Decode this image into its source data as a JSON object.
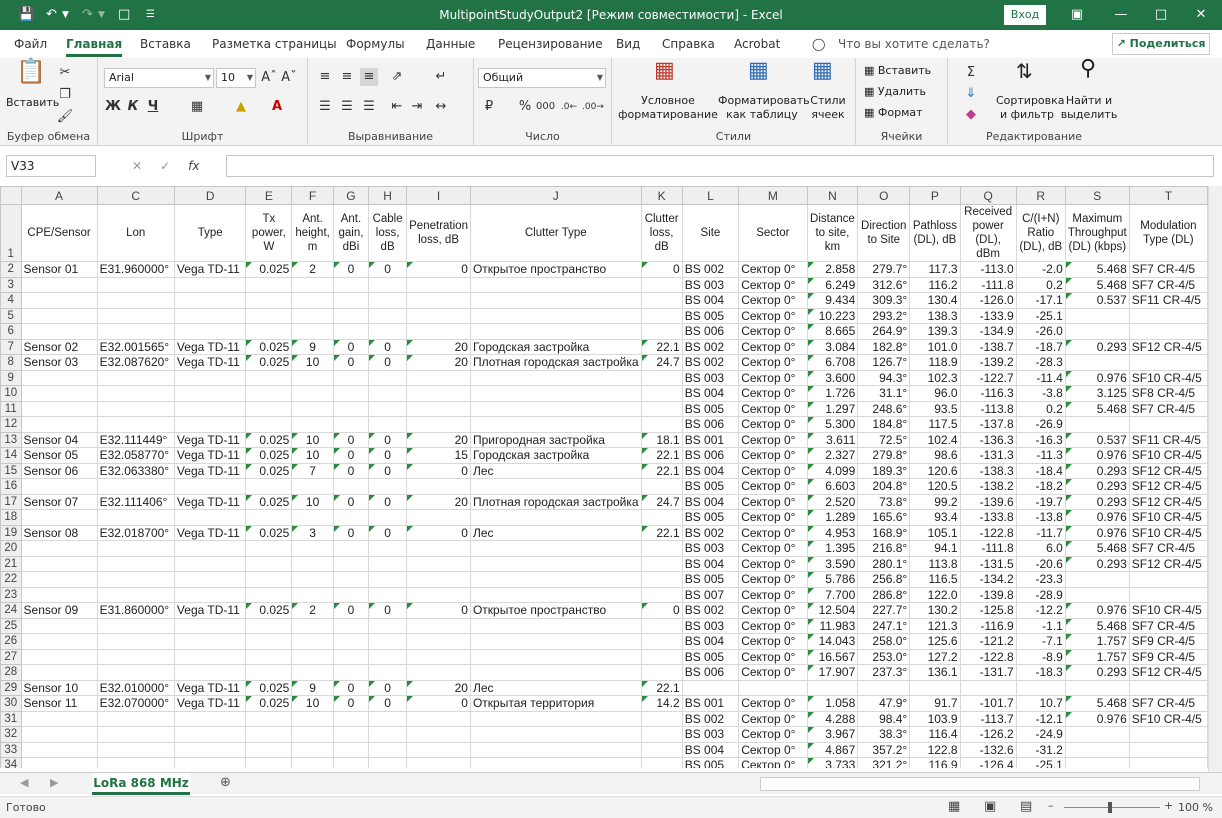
{
  "titlebar": {
    "title": "MultipointStudyOutput2  [Режим совместимости]  -  Excel",
    "signin": "Вход",
    "save_icon": "save-icon",
    "undo_icon": "undo-icon",
    "redo_icon": "redo-icon",
    "new_icon": "new-file-icon"
  },
  "tabs": [
    "Файл",
    "Главная",
    "Вставка",
    "Разметка страницы",
    "Формулы",
    "Данные",
    "Рецензирование",
    "Вид",
    "Справка",
    "Acrobat"
  ],
  "tellme": "Что вы хотите сделать?",
  "share": "Поделиться",
  "ribbon": {
    "paste": "Вставить",
    "clipboard": "Буфер обмена",
    "font_name": "Arial",
    "font_size": "10",
    "font_group": "Шрифт",
    "bold": "Ж",
    "italic": "К",
    "underline": "Ч",
    "align_group": "Выравнивание",
    "number_format": "Общий",
    "number_group": "Число",
    "cond_format": "Условное форматирование",
    "format_table": "Форматировать как таблицу",
    "cell_styles": "Стили ячеек",
    "styles_group": "Стили",
    "insert": "Вставить",
    "delete": "Удалить",
    "format": "Формат",
    "cells_group": "Ячейки",
    "sort": "Сортировка и фильтр",
    "find": "Найти и выделить",
    "edit_group": "Редактирование"
  },
  "namebox": "V33",
  "columns": [
    "A",
    "C",
    "D",
    "E",
    "F",
    "G",
    "H",
    "I",
    "J",
    "K",
    "L",
    "M",
    "N",
    "O",
    "P",
    "Q",
    "R",
    "S",
    "T"
  ],
  "headers": [
    "CPE/Sensor",
    "Lon",
    "Type",
    "Tx power, W",
    "Ant. height, m",
    "Ant. gain, dBi",
    "Cable loss, dB",
    "Penetration loss, dB",
    "Clutter Type",
    "Clutter loss, dB",
    "Site",
    "Sector",
    "Distance to site, km",
    "Direction to Site",
    "Pathloss (DL), dB",
    "Received power (DL), dBm",
    "C/(I+N) Ratio (DL), dB",
    "Maximum Throughput (DL) (kbps)",
    "Modulation Type (DL)"
  ],
  "rows": [
    [
      "2",
      "Sensor 01",
      "E31.960000°",
      "Vega TD-11",
      "0.025",
      "2",
      "0",
      "0",
      "0",
      "Открытое пространство",
      "0",
      "BS 002",
      "Сектор 0°",
      "2.858",
      "279.7°",
      "117.3",
      "-113.0",
      "-2.0",
      "5.468",
      "SF7 CR-4/5"
    ],
    [
      "3",
      "",
      "",
      "",
      "",
      "",
      "",
      "",
      "",
      "",
      "",
      "BS 003",
      "Сектор 0°",
      "6.249",
      "312.6°",
      "116.2",
      "-111.8",
      "0.2",
      "5.468",
      "SF7 CR-4/5"
    ],
    [
      "4",
      "",
      "",
      "",
      "",
      "",
      "",
      "",
      "",
      "",
      "",
      "BS 004",
      "Сектор 0°",
      "9.434",
      "309.3°",
      "130.4",
      "-126.0",
      "-17.1",
      "0.537",
      "SF11 CR-4/5"
    ],
    [
      "5",
      "",
      "",
      "",
      "",
      "",
      "",
      "",
      "",
      "",
      "",
      "BS 005",
      "Сектор 0°",
      "10.223",
      "293.2°",
      "138.3",
      "-133.9",
      "-25.1",
      "",
      ""
    ],
    [
      "6",
      "",
      "",
      "",
      "",
      "",
      "",
      "",
      "",
      "",
      "",
      "BS 006",
      "Сектор 0°",
      "8.665",
      "264.9°",
      "139.3",
      "-134.9",
      "-26.0",
      "",
      ""
    ],
    [
      "7",
      "Sensor 02",
      "E32.001565°",
      "Vega TD-11",
      "0.025",
      "9",
      "0",
      "0",
      "20",
      "Городская застройка",
      "22.1",
      "BS 002",
      "Сектор 0°",
      "3.084",
      "182.8°",
      "101.0",
      "-138.7",
      "-18.7",
      "0.293",
      "SF12 CR-4/5"
    ],
    [
      "8",
      "Sensor 03",
      "E32.087620°",
      "Vega TD-11",
      "0.025",
      "10",
      "0",
      "0",
      "20",
      "Плотная городская застройка",
      "24.7",
      "BS 002",
      "Сектор 0°",
      "6.708",
      "126.7°",
      "118.9",
      "-139.2",
      "-28.3",
      "",
      ""
    ],
    [
      "9",
      "",
      "",
      "",
      "",
      "",
      "",
      "",
      "",
      "",
      "",
      "BS 003",
      "Сектор 0°",
      "3.600",
      "94.3°",
      "102.3",
      "-122.7",
      "-11.4",
      "0.976",
      "SF10 CR-4/5"
    ],
    [
      "10",
      "",
      "",
      "",
      "",
      "",
      "",
      "",
      "",
      "",
      "",
      "BS 004",
      "Сектор 0°",
      "1.726",
      "31.1°",
      "96.0",
      "-116.3",
      "-3.8",
      "3.125",
      "SF8 CR-4/5"
    ],
    [
      "11",
      "",
      "",
      "",
      "",
      "",
      "",
      "",
      "",
      "",
      "",
      "BS 005",
      "Сектор 0°",
      "1.297",
      "248.6°",
      "93.5",
      "-113.8",
      "0.2",
      "5.468",
      "SF7 CR-4/5"
    ],
    [
      "12",
      "",
      "",
      "",
      "",
      "",
      "",
      "",
      "",
      "",
      "",
      "BS 006",
      "Сектор 0°",
      "5.300",
      "184.8°",
      "117.5",
      "-137.8",
      "-26.9",
      "",
      ""
    ],
    [
      "13",
      "Sensor 04",
      "E32.111449°",
      "Vega TD-11",
      "0.025",
      "10",
      "0",
      "0",
      "20",
      "Пригородная застройка",
      "18.1",
      "BS 001",
      "Сектор 0°",
      "3.611",
      "72.5°",
      "102.4",
      "-136.3",
      "-16.3",
      "0.537",
      "SF11 CR-4/5"
    ],
    [
      "14",
      "Sensor 05",
      "E32.058770°",
      "Vega TD-11",
      "0.025",
      "10",
      "0",
      "0",
      "15",
      "Городская застройка",
      "22.1",
      "BS 006",
      "Сектор 0°",
      "2.327",
      "279.8°",
      "98.6",
      "-131.3",
      "-11.3",
      "0.976",
      "SF10 CR-4/5"
    ],
    [
      "15",
      "Sensor 06",
      "E32.063380°",
      "Vega TD-11",
      "0.025",
      "7",
      "0",
      "0",
      "0",
      "Лес",
      "22.1",
      "BS 004",
      "Сектор 0°",
      "4.099",
      "189.3°",
      "120.6",
      "-138.3",
      "-18.4",
      "0.293",
      "SF12 CR-4/5"
    ],
    [
      "16",
      "",
      "",
      "",
      "",
      "",
      "",
      "",
      "",
      "",
      "",
      "BS 005",
      "Сектор 0°",
      "6.603",
      "204.8°",
      "120.5",
      "-138.2",
      "-18.2",
      "0.293",
      "SF12 CR-4/5"
    ],
    [
      "17",
      "Sensor 07",
      "E32.111406°",
      "Vega TD-11",
      "0.025",
      "10",
      "0",
      "0",
      "20",
      "Плотная городская застройка",
      "24.7",
      "BS 004",
      "Сектор 0°",
      "2.520",
      "73.8°",
      "99.2",
      "-139.6",
      "-19.7",
      "0.293",
      "SF12 CR-4/5"
    ],
    [
      "18",
      "",
      "",
      "",
      "",
      "",
      "",
      "",
      "",
      "",
      "",
      "BS 005",
      "Сектор 0°",
      "1.289",
      "165.6°",
      "93.4",
      "-133.8",
      "-13.8",
      "0.976",
      "SF10 CR-4/5"
    ],
    [
      "19",
      "Sensor 08",
      "E32.018700°",
      "Vega TD-11",
      "0.025",
      "3",
      "0",
      "0",
      "0",
      "Лес",
      "22.1",
      "BS 002",
      "Сектор 0°",
      "4.953",
      "168.9°",
      "105.1",
      "-122.8",
      "-11.7",
      "0.976",
      "SF10 CR-4/5"
    ],
    [
      "20",
      "",
      "",
      "",
      "",
      "",
      "",
      "",
      "",
      "",
      "",
      "BS 003",
      "Сектор 0°",
      "1.395",
      "216.8°",
      "94.1",
      "-111.8",
      "6.0",
      "5.468",
      "SF7 CR-4/5"
    ],
    [
      "21",
      "",
      "",
      "",
      "",
      "",
      "",
      "",
      "",
      "",
      "",
      "BS 004",
      "Сектор 0°",
      "3.590",
      "280.1°",
      "113.8",
      "-131.5",
      "-20.6",
      "0.293",
      "SF12 CR-4/5"
    ],
    [
      "22",
      "",
      "",
      "",
      "",
      "",
      "",
      "",
      "",
      "",
      "",
      "BS 005",
      "Сектор 0°",
      "5.786",
      "256.8°",
      "116.5",
      "-134.2",
      "-23.3",
      "",
      ""
    ],
    [
      "23",
      "",
      "",
      "",
      "",
      "",
      "",
      "",
      "",
      "",
      "",
      "BS 007",
      "Сектор 0°",
      "7.700",
      "286.8°",
      "122.0",
      "-139.8",
      "-28.9",
      "",
      ""
    ],
    [
      "24",
      "Sensor 09",
      "E31.860000°",
      "Vega TD-11",
      "0.025",
      "2",
      "0",
      "0",
      "0",
      "Открытое пространство",
      "0",
      "BS 002",
      "Сектор 0°",
      "12.504",
      "227.7°",
      "130.2",
      "-125.8",
      "-12.2",
      "0.976",
      "SF10 CR-4/5"
    ],
    [
      "25",
      "",
      "",
      "",
      "",
      "",
      "",
      "",
      "",
      "",
      "",
      "BS 003",
      "Сектор 0°",
      "11.983",
      "247.1°",
      "121.3",
      "-116.9",
      "-1.1",
      "5.468",
      "SF7 CR-4/5"
    ],
    [
      "26",
      "",
      "",
      "",
      "",
      "",
      "",
      "",
      "",
      "",
      "",
      "BS 004",
      "Сектор 0°",
      "14.043",
      "258.0°",
      "125.6",
      "-121.2",
      "-7.1",
      "1.757",
      "SF9 CR-4/5"
    ],
    [
      "27",
      "",
      "",
      "",
      "",
      "",
      "",
      "",
      "",
      "",
      "",
      "BS 005",
      "Сектор 0°",
      "16.567",
      "253.0°",
      "127.2",
      "-122.8",
      "-8.9",
      "1.757",
      "SF9 CR-4/5"
    ],
    [
      "28",
      "",
      "",
      "",
      "",
      "",
      "",
      "",
      "",
      "",
      "",
      "BS 006",
      "Сектор 0°",
      "17.907",
      "237.3°",
      "136.1",
      "-131.7",
      "-18.3",
      "0.293",
      "SF12 CR-4/5"
    ],
    [
      "29",
      "Sensor 10",
      "E32.010000°",
      "Vega TD-11",
      "0.025",
      "9",
      "0",
      "0",
      "20",
      "Лес",
      "22.1",
      "",
      "",
      "",
      "",
      "",
      "",
      "",
      "",
      ""
    ],
    [
      "30",
      "Sensor 11",
      "E32.070000°",
      "Vega TD-11",
      "0.025",
      "10",
      "0",
      "0",
      "0",
      "Открытая территория",
      "14.2",
      "BS 001",
      "Сектор 0°",
      "1.058",
      "47.9°",
      "91.7",
      "-101.7",
      "10.7",
      "5.468",
      "SF7 CR-4/5"
    ],
    [
      "31",
      "",
      "",
      "",
      "",
      "",
      "",
      "",
      "",
      "",
      "",
      "BS 002",
      "Сектор 0°",
      "4.288",
      "98.4°",
      "103.9",
      "-113.7",
      "-12.1",
      "0.976",
      "SF10 CR-4/5"
    ],
    [
      "32",
      "",
      "",
      "",
      "",
      "",
      "",
      "",
      "",
      "",
      "",
      "BS 003",
      "Сектор 0°",
      "3.967",
      "38.3°",
      "116.4",
      "-126.2",
      "-24.9",
      "",
      ""
    ],
    [
      "33",
      "",
      "",
      "",
      "",
      "",
      "",
      "",
      "",
      "",
      "",
      "BS 004",
      "Сектор 0°",
      "4.867",
      "357.2°",
      "122.8",
      "-132.6",
      "-31.2",
      "",
      ""
    ],
    [
      "34",
      "",
      "",
      "",
      "",
      "",
      "",
      "",
      "",
      "",
      "",
      "BS 005",
      "Сектор 0°",
      "3.733",
      "321.2°",
      "116.9",
      "-126.4",
      "-25.1",
      "",
      ""
    ]
  ],
  "sheet_tab": "LoRa 868 MHz",
  "status": "Готово",
  "zoom": "100 %"
}
